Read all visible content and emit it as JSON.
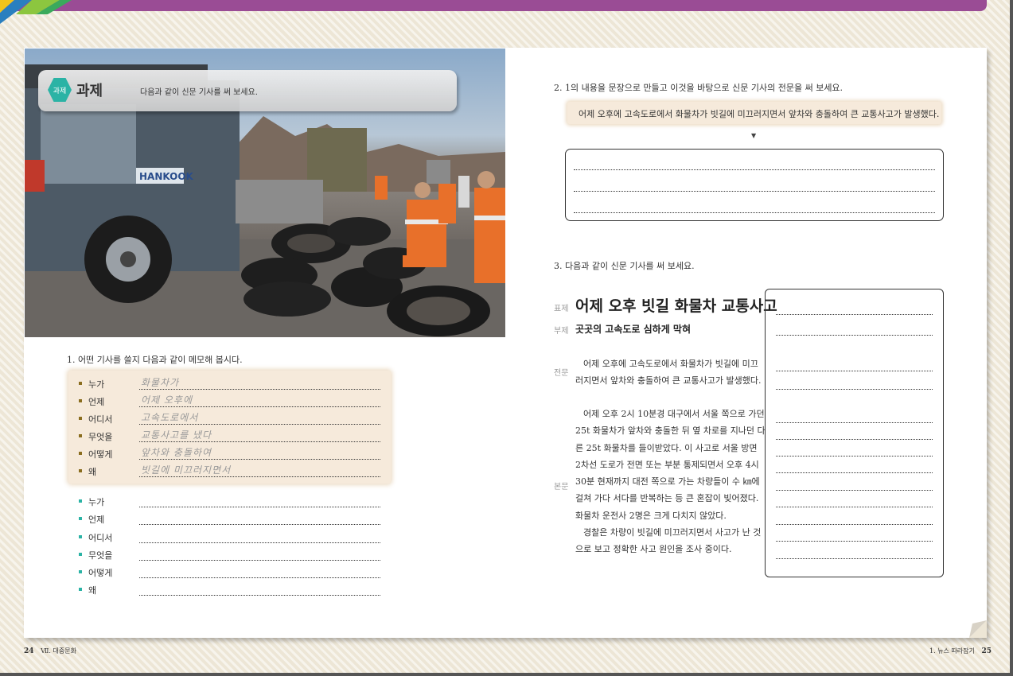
{
  "left_page": {
    "task": {
      "badge": "과제",
      "title": "과제",
      "instruction": "다음과 같이 신문 기사를 써 보세요."
    },
    "q1": {
      "text": "1. 어떤 기사를 쓸지 다음과 같이 메모해 봅시다.",
      "example": [
        {
          "label": "누가",
          "answer": "화물차가"
        },
        {
          "label": "언제",
          "answer": "어제 오후에"
        },
        {
          "label": "어디서",
          "answer": "고속도로에서"
        },
        {
          "label": "무엇을",
          "answer": "교통사고를 냈다"
        },
        {
          "label": "어떻게",
          "answer": "앞차와 충돌하여"
        },
        {
          "label": "왜",
          "answer": "빗길에 미끄러지면서"
        }
      ],
      "blank": [
        "누가",
        "언제",
        "어디서",
        "무엇을",
        "어떻게",
        "왜"
      ]
    },
    "footer": {
      "page": "24",
      "section": "Ⅶ. 대중문화"
    }
  },
  "right_page": {
    "q2": {
      "text": "2. 1의 내용을 문장으로 만들고 이것을 바탕으로 신문 기사의 전문을 써 보세요.",
      "lead_sentence": "어제 오후에 고속도로에서 화물차가 빗길에 미끄러지면서 앞차와 충돌하여 큰 교통사고가 발생했다.",
      "arrow": "▼"
    },
    "q3": {
      "text": "3. 다음과 같이 신문 기사를 써 보세요."
    },
    "article": {
      "labels": {
        "headline": "표제",
        "subhead": "부제",
        "lead": "전문",
        "body": "본문"
      },
      "headline": "어제 오후 빗길 화물차 교통사고",
      "subhead": "곳곳의 고속도로 심하게 막혀",
      "lead": [
        "어제 오후에 고속도로에서 화물차가 빗길에 미끄",
        "러지면서 앞차와 충돌하여 큰 교통사고가 발생했다."
      ],
      "body": [
        "어제 오후 2시 10분경 대구에서 서울 쪽으로 가던",
        "25t 화물차가 앞차와 충돌한 뒤 옆 차로를 지나던 다",
        "른 25t 화물차를 들이받았다. 이 사고로 서울 방면",
        "2차선 도로가 전면 또는 부분 통제되면서 오후 4시",
        "30분 현재까지 대전 쪽으로 가는 차량들이 수 ㎞에",
        "걸쳐 가다 서다를 반복하는 등 큰 혼잡이 빚어졌다.",
        "화물차 운전사 2명은 크게 다치지 않았다.",
        "경찰은 차량이 빗길에 미끄러지면서 사고가 난 것",
        "으로 보고 정확한 사고 원인을 조사 중이다."
      ]
    },
    "footer": {
      "section": "1. 뉴스 따라잡기",
      "page": "25"
    }
  },
  "colors": {
    "accent_purple": "#9a4c95",
    "task_teal": "#2bb3a5",
    "memo_bg": "#f6eadb",
    "bullet_brown": "#8a6d1e",
    "bullet_teal": "#2bb3a5"
  },
  "icons": {
    "arrow": "down-triangle-icon",
    "badge": "hexagon-icon"
  }
}
